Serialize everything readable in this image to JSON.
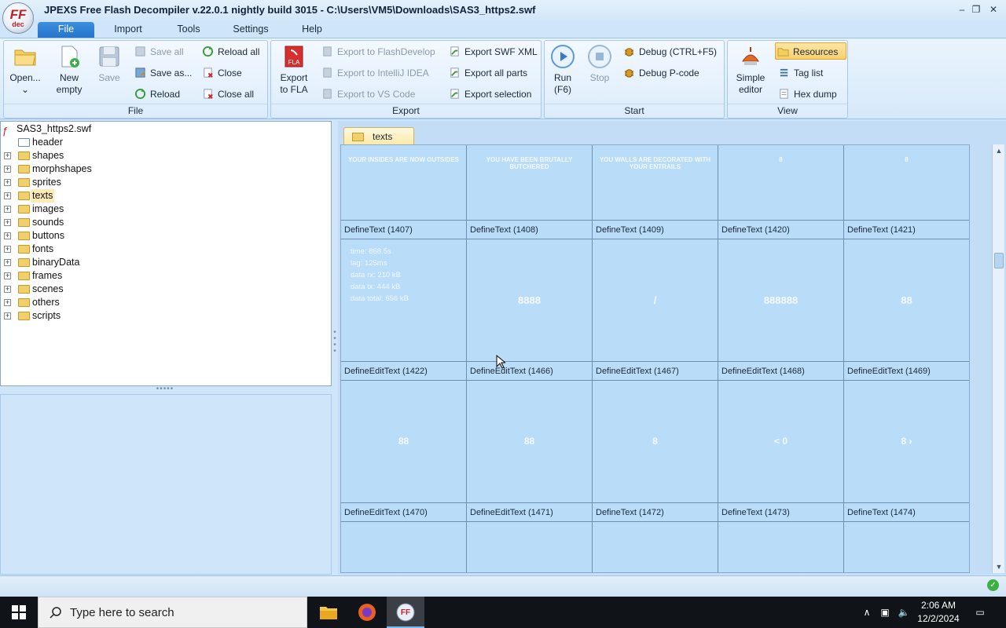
{
  "window": {
    "title": "JPEXS Free Flash Decompiler v.22.0.1 nightly build 3015 - C:\\Users\\VM5\\Downloads\\SAS3_https2.swf",
    "logo_text": "FF",
    "logo_sub": "dec",
    "minimize": "–",
    "restore": "❐",
    "close": "✕"
  },
  "menu_tabs": [
    "File",
    "Import",
    "Tools",
    "Settings",
    "Help"
  ],
  "ribbon": {
    "file": {
      "label": "File",
      "open": "Open...",
      "new_empty_1": "New",
      "new_empty_2": "empty",
      "save": "Save",
      "save_all": "Save all",
      "save_as": "Save as...",
      "reload": "Reload",
      "reload_all": "Reload all",
      "close": "Close",
      "close_all": "Close all"
    },
    "export": {
      "label": "Export",
      "export_fla_1": "Export",
      "export_fla_2": "to FLA",
      "flashdevelop": "Export to FlashDevelop",
      "intellij": "Export to IntelliJ IDEA",
      "vscode": "Export to VS Code",
      "swf_xml": "Export SWF XML",
      "all_parts": "Export all parts",
      "selection": "Export selection"
    },
    "start": {
      "label": "Start",
      "run_1": "Run",
      "run_2": "(F6)",
      "stop": "Stop",
      "debug": "Debug (CTRL+F5)",
      "debug_pcode": "Debug P-code"
    },
    "view": {
      "label": "View",
      "simple_editor_1": "Simple",
      "simple_editor_2": "editor",
      "resources": "Resources",
      "tag_list": "Tag list",
      "hex_dump": "Hex dump"
    }
  },
  "tree": {
    "root": "SAS3_https2.swf",
    "items": [
      "header",
      "shapes",
      "morphshapes",
      "sprites",
      "texts",
      "images",
      "sounds",
      "buttons",
      "fonts",
      "binaryData",
      "frames",
      "scenes",
      "others",
      "scripts"
    ],
    "selected": "texts"
  },
  "content_tab": "texts",
  "grid": {
    "row1": {
      "previews": [
        "YOUR INSIDES ARE NOW OUTSIDES",
        "YOU HAVE BEEN BRUTALLY BUTCHERED",
        "YOU WALLS ARE DECORATED WITH YOUR ENTRAILS",
        "8",
        "8"
      ],
      "captions": [
        "DefineText (1407)",
        "DefineText (1408)",
        "DefineText (1409)",
        "DefineText (1420)",
        "DefineText (1421)"
      ]
    },
    "row2": {
      "stats": [
        "time: 868.5s",
        "lag: 125ms",
        "data rx: 210 kB",
        "data tx: 444 kB",
        "data total: 656 kB"
      ],
      "previews": [
        "",
        "8888",
        "/",
        "888888",
        "88"
      ],
      "captions": [
        "DefineEditText (1422)",
        "DefineEditText (1466)",
        "DefineEditText (1467)",
        "DefineEditText (1468)",
        "DefineEditText (1469)"
      ]
    },
    "row3": {
      "previews": [
        "88",
        "88",
        "8",
        "< 0",
        "8 ›"
      ],
      "captions": [
        "DefineEditText (1470)",
        "DefineEditText (1471)",
        "DefineText (1472)",
        "DefineText (1473)",
        "DefineText (1474)"
      ]
    }
  },
  "taskbar": {
    "search_placeholder": "Type here to search",
    "time": "2:06 AM",
    "date": "12/2/2024"
  },
  "colors": {
    "accent": "#2475cc",
    "panel_bg": "#cfe6fa",
    "grid_bg": "#b9dcf8"
  }
}
